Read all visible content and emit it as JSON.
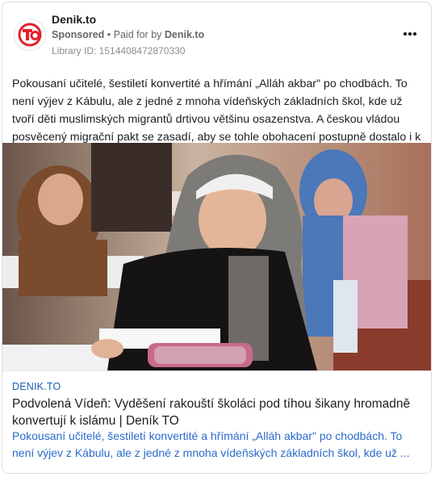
{
  "post": {
    "page_name": "Denik.to",
    "sponsored_label": "Sponsored",
    "paid_for_label": "Paid for by",
    "paid_by": "Denik.to",
    "library_id": "Library ID: 1514408472870330",
    "body_text": "Pokousaní učitelé, šestiletí konvertité a hřímání „Alláh akbar\" po chodbách. To není výjev z Kábulu, ale z jedné z mnoha vídeňských základních škol, kde už tvoří děti muslimských migrantů drtivou většinu osazenstva. A českou vládou posvěcený migrační pakt se zasadí, aby se tohle obohacení postupně dostalo i k nám."
  },
  "link": {
    "domain": "DENIK.TO",
    "title": "Podvolená Vídeň: Vyděšení rakouští školáci pod tíhou šikany hromadně konvertují k islámu | Deník TO",
    "description": "Pokousaní učitelé, šestiletí konvertité a hřímání „Alláh akbar\" po chodbách. To není výjev z Kábulu, ale z jedné z mnoha vídeňských základních škol, kde už ..."
  },
  "icons": {
    "logo": "denik-to-logo",
    "more": "more-options-icon"
  },
  "colors": {
    "brand_red": "#e3222b",
    "link_blue": "#2a6acb"
  }
}
